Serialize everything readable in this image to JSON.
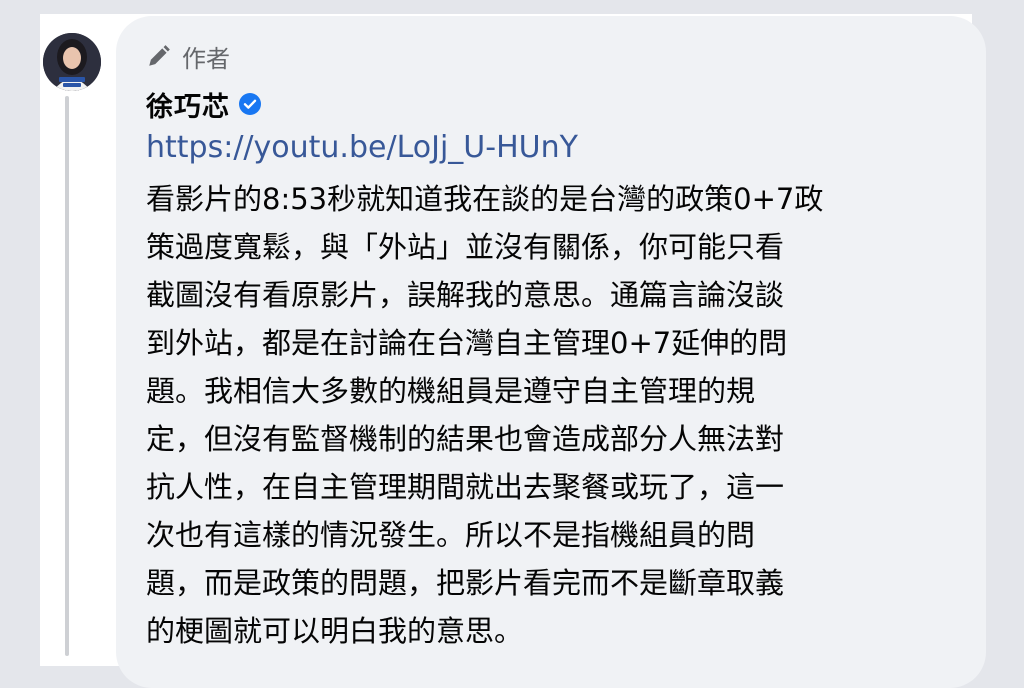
{
  "comment": {
    "author_badge": "作者",
    "author_badge_icon": "pencil-icon",
    "author_name": "徐巧芯",
    "verified_icon": "verified-badge-icon",
    "verified_color": "#1877f2",
    "link_text": "https://youtu.be/LoJj_U-HUnY",
    "link_color": "#385898",
    "body_lines": [
      "看影片的8:53秒就知道我在談的是台灣的政策0+7政",
      "策過度寬鬆，與「外站」並沒有關係，你可能只看",
      "截圖沒有看原影片，誤解我的意思。通篇言論沒談",
      "到外站，都是在討論在台灣自主管理0+7延伸的問",
      "題。我相信大多數的機組員是遵守自主管理的規",
      "定，但沒有監督機制的結果也會造成部分人無法對",
      "抗人性，在自主管理期間就出去聚餐或玩了，這一",
      "次也有這樣的情況發生。所以不是指機組員的問",
      "題，而是政策的問題，把影片看完而不是斷章取義",
      "的梗圖就可以明白我的意思。"
    ]
  }
}
